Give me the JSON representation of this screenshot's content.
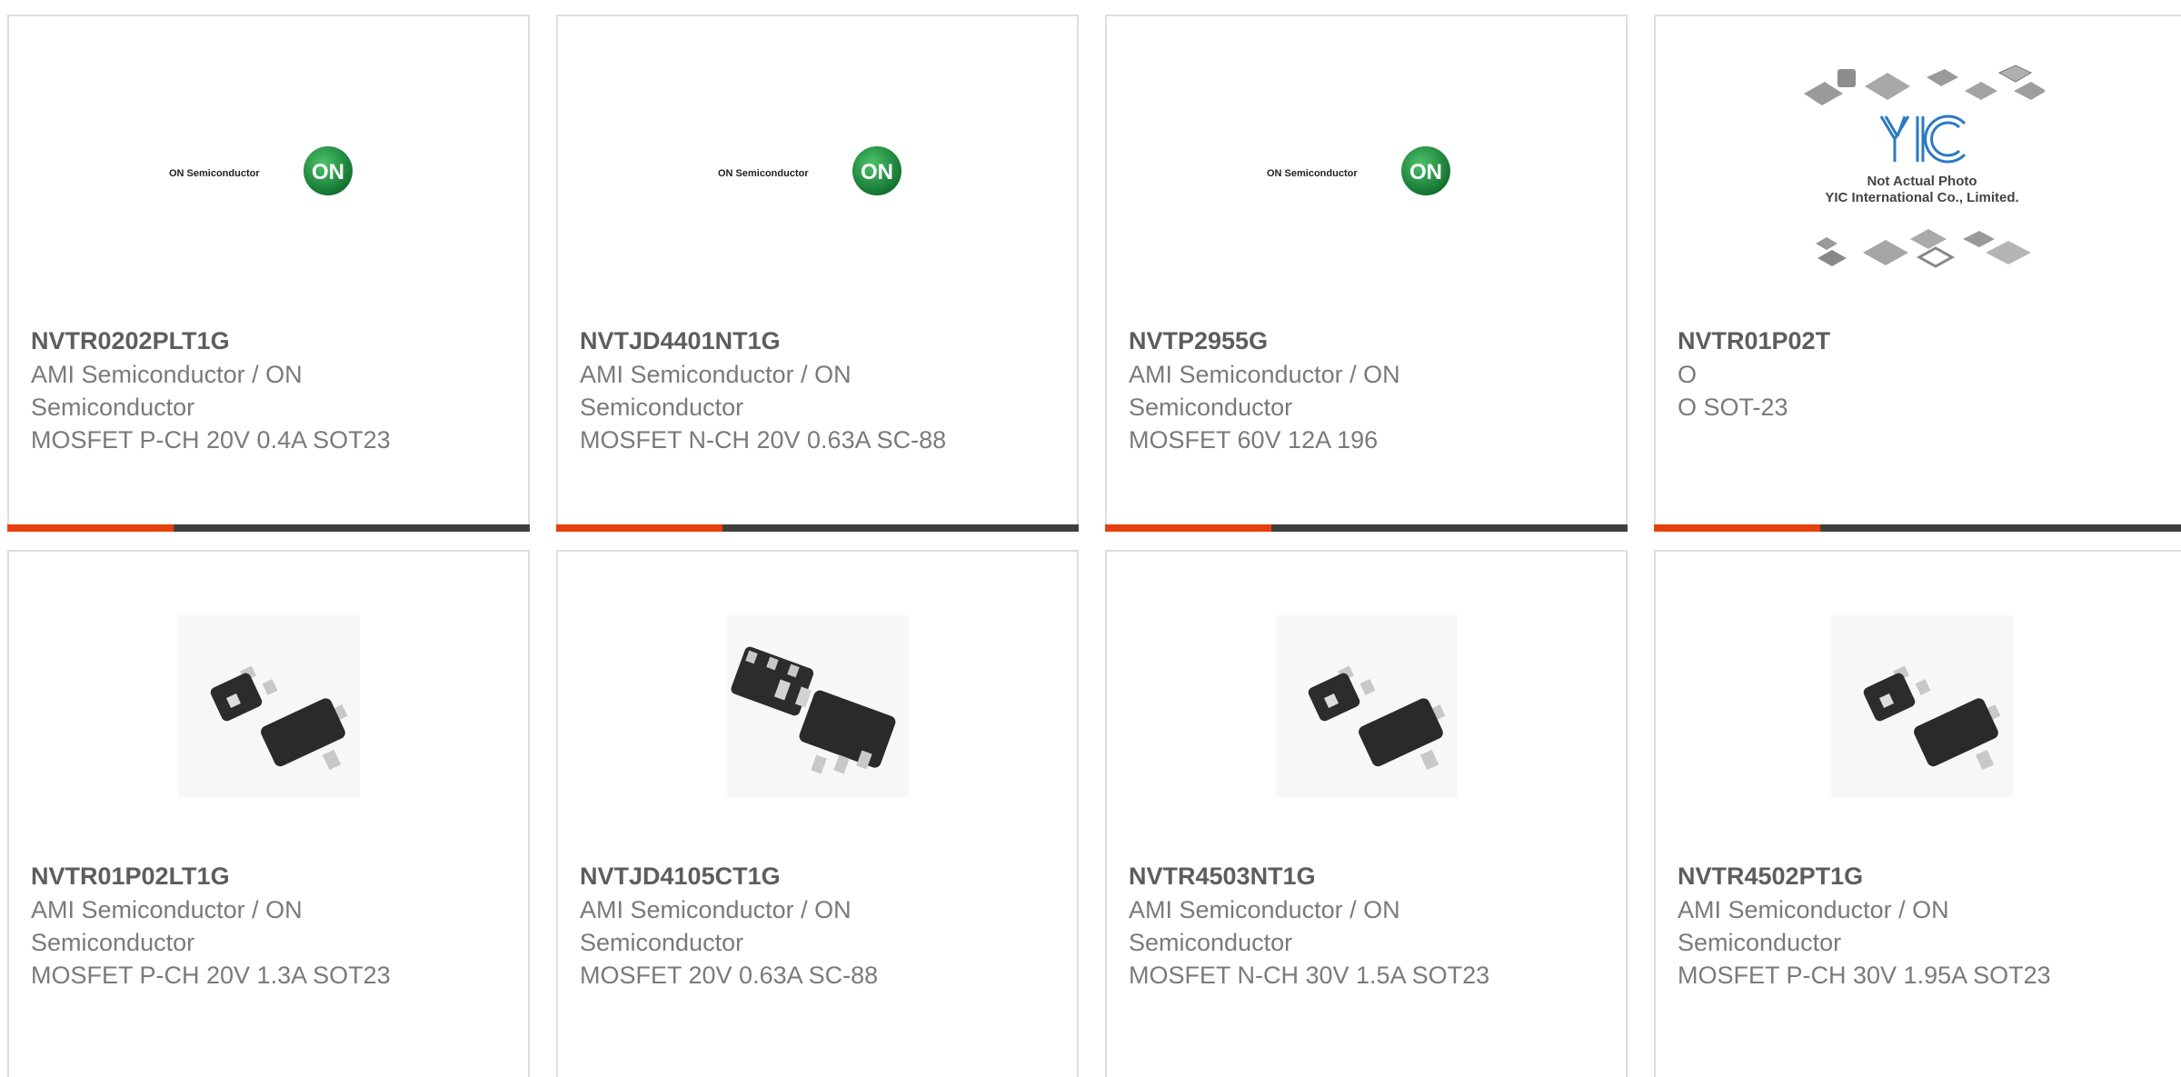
{
  "products": [
    {
      "part": "NVTR0202PLT1G",
      "manufacturer": "AMI Semiconductor / ON Semiconductor",
      "description": "MOSFET P-CH 20V 0.4A SOT23",
      "image": "on-semiconductor-logo",
      "logo_text": "ON Semiconductor",
      "logo_badge": "ON"
    },
    {
      "part": "NVTJD4401NT1G",
      "manufacturer": "AMI Semiconductor / ON Semiconductor",
      "description": "MOSFET N-CH 20V 0.63A SC-88",
      "image": "on-semiconductor-logo",
      "logo_text": "ON Semiconductor",
      "logo_badge": "ON"
    },
    {
      "part": "NVTP2955G",
      "manufacturer": "AMI Semiconductor / ON Semiconductor",
      "description": "MOSFET 60V 12A 196",
      "image": "on-semiconductor-logo",
      "logo_text": "ON Semiconductor",
      "logo_badge": "ON"
    },
    {
      "part": "NVTR01P02T",
      "manufacturer": "O",
      "description": "O SOT-23",
      "image": "yic-placeholder",
      "placeholder_line1": "Not Actual Photo",
      "placeholder_line2": "YIC International Co., Limited."
    },
    {
      "part": "NVTR01P02LT1G",
      "manufacturer": "AMI Semiconductor / ON Semiconductor",
      "description": "MOSFET P-CH 20V 1.3A SOT23",
      "image": "sot23-package-photo"
    },
    {
      "part": "NVTJD4105CT1G",
      "manufacturer": "AMI Semiconductor / ON Semiconductor",
      "description": "MOSFET 20V 0.63A SC-88",
      "image": "sc88-package-photo"
    },
    {
      "part": "NVTR4503NT1G",
      "manufacturer": "AMI Semiconductor / ON Semiconductor",
      "description": "MOSFET N-CH 30V 1.5A SOT23",
      "image": "sot23-package-photo"
    },
    {
      "part": "NVTR4502PT1G",
      "manufacturer": "AMI Semiconductor / ON Semiconductor",
      "description": "MOSFET P-CH 30V 1.95A SOT23",
      "image": "sot23-package-photo"
    }
  ],
  "colors": {
    "accent": "#e8400c",
    "bar": "#3f3f3f",
    "on_green": "#1f8a3a"
  }
}
